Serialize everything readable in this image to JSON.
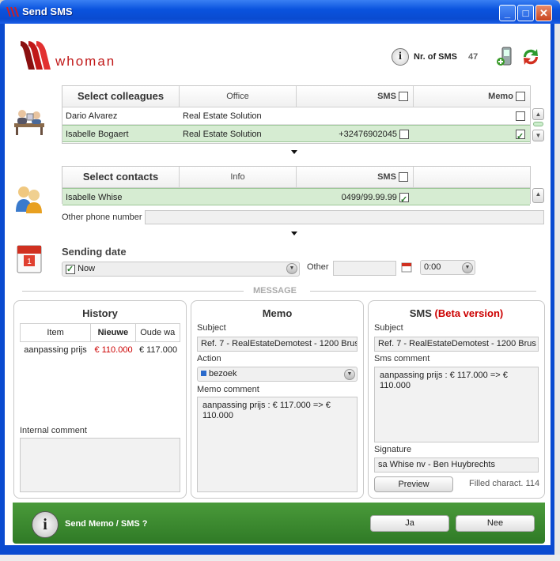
{
  "window": {
    "title": "Send SMS",
    "minimize": "_",
    "maximize": "□",
    "close": "✕"
  },
  "header": {
    "nr_sms_label": "Nr. of SMS",
    "nr_sms_value": "47"
  },
  "colleagues": {
    "columns": [
      "Select colleagues",
      "Office",
      "SMS",
      "Memo"
    ],
    "rows": [
      {
        "name": "Dario Alvarez",
        "office": "Real Estate Solution",
        "phone": "",
        "sms_checked": false,
        "memo_checked": false
      },
      {
        "name": "Isabelle Bogaert",
        "office": "Real Estate Solution",
        "phone": "+32476902045",
        "sms_checked": false,
        "memo_checked": true
      }
    ]
  },
  "contacts": {
    "columns": [
      "Select contacts",
      "Info",
      "SMS"
    ],
    "rows": [
      {
        "name": "Isabelle Whise",
        "phone": "0499/99.99.99",
        "sms_checked": true
      }
    ],
    "other_phone_label": "Other phone number",
    "other_phone_value": ""
  },
  "sending": {
    "label": "Sending date",
    "now_value": "Now",
    "other_label": "Other",
    "other_date": "",
    "time_value": "0:00"
  },
  "message_divider": "MESSAGE",
  "history": {
    "title": "History",
    "columns": [
      "Item",
      "Nieuwe",
      "Oude wa"
    ],
    "rows": [
      {
        "item": "aanpassing  prijs",
        "new": "€ 110.000",
        "old": "€ 117.000"
      }
    ],
    "internal_comment_label": "Internal comment",
    "internal_comment": ""
  },
  "memo": {
    "title": "Memo",
    "subject_label": "Subject",
    "subject_value": "Ref. 7 - RealEstateDemotest - 1200 Brus",
    "action_label": "Action",
    "action_value": "bezoek",
    "comment_label": "Memo comment",
    "comment_value": "aanpassing  prijs : € 117.000 => € 110.000"
  },
  "sms": {
    "title": "SMS",
    "beta": "(Beta version)",
    "subject_label": "Subject",
    "subject_value": "Ref. 7 - RealEstateDemotest - 1200 Brus",
    "comment_label": "Sms comment",
    "comment_value": "aanpassing  prijs : € 117.000 => € 110.000",
    "signature_label": "Signature",
    "signature_value": "sa Whise nv - Ben Huybrechts",
    "preview_label": "Preview",
    "filled_label": "Filled charact. 114"
  },
  "footer": {
    "question": "Send Memo / SMS ?",
    "yes_label": "Ja",
    "no_label": "Nee"
  },
  "colors": {
    "accent_green": "#2f7a26",
    "selection": "#d6ecd2",
    "beta_red": "#cc0000",
    "titlebar_blue": "#0a4bd0"
  }
}
